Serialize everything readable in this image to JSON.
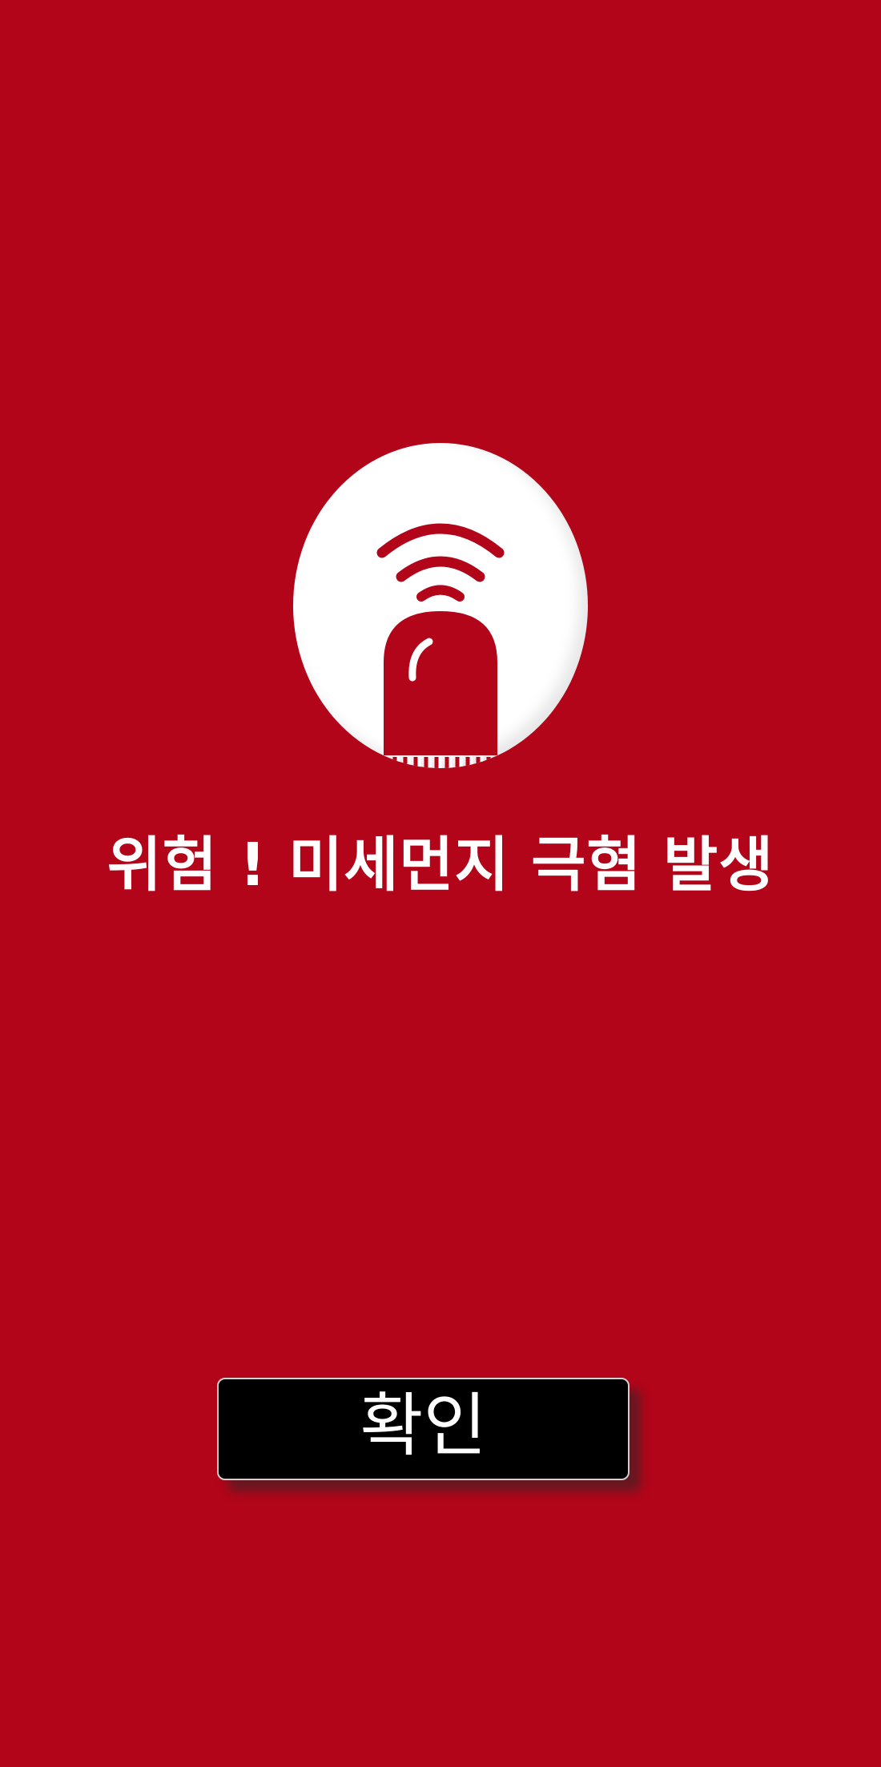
{
  "colors": {
    "background": "#B2051A",
    "alarm_circle": "#FFFFFF",
    "alarm_icon": "#B2051A",
    "headline_text": "#FFFFFF",
    "button_background": "#000000",
    "button_text": "#FFFFFF"
  },
  "alert": {
    "icon": "siren-alarm-icon",
    "message": "위험 ! 미세먼지 극혐 발생"
  },
  "dialog": {
    "confirm_label": "확인"
  }
}
